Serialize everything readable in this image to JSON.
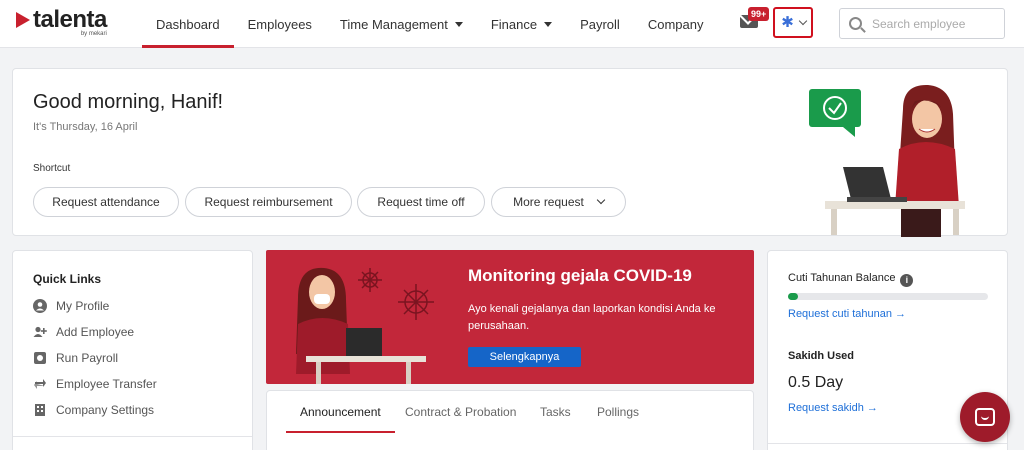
{
  "brand": {
    "name": "talenta",
    "sub": "by mekari",
    "color": "#c8202e"
  },
  "nav": {
    "items": [
      {
        "label": "Dashboard",
        "active": true,
        "dropdown": false
      },
      {
        "label": "Employees",
        "active": false,
        "dropdown": false
      },
      {
        "label": "Time Management",
        "active": false,
        "dropdown": true
      },
      {
        "label": "Finance",
        "active": false,
        "dropdown": true
      },
      {
        "label": "Payroll",
        "active": false,
        "dropdown": false
      },
      {
        "label": "Company",
        "active": false,
        "dropdown": false
      }
    ],
    "inbox_badge": "99+",
    "search_placeholder": "Search employee",
    "search_value": ""
  },
  "greeting": {
    "title": "Good morning, Hanif!",
    "date": "It's Thursday, 16 April",
    "shortcut_label": "Shortcut",
    "shortcuts": [
      "Request attendance",
      "Request reimbursement",
      "Request time off",
      "More request"
    ]
  },
  "quick_links": {
    "title": "Quick Links",
    "items": [
      {
        "label": "My Profile",
        "icon": "profile-icon"
      },
      {
        "label": "Add Employee",
        "icon": "add-user-icon"
      },
      {
        "label": "Run Payroll",
        "icon": "payroll-icon"
      },
      {
        "label": "Employee Transfer",
        "icon": "transfer-icon"
      },
      {
        "label": "Company Settings",
        "icon": "building-icon"
      }
    ]
  },
  "banner": {
    "title": "Monitoring gejala COVID-19",
    "text": "Ayo kenali gejalanya dan laporkan kondisi Anda ke perusahaan.",
    "button": "Selengkapnya",
    "color": "#c2273a"
  },
  "tabs": [
    "Announcement",
    "Contract & Probation",
    "Tasks",
    "Pollings"
  ],
  "balance": {
    "cuti_title": "Cuti Tahunan Balance",
    "cuti_progress": 0.05,
    "cuti_link": "Request cuti tahunan →",
    "sakit_title": "Sakidh Used",
    "sakit_value": "0.5 Day",
    "sakit_link": "Request sakidh →"
  },
  "colors": {
    "accent": "#c8202e",
    "link": "#1e6fd8",
    "progress": "#1a9b4b",
    "button": "#1565c8"
  }
}
